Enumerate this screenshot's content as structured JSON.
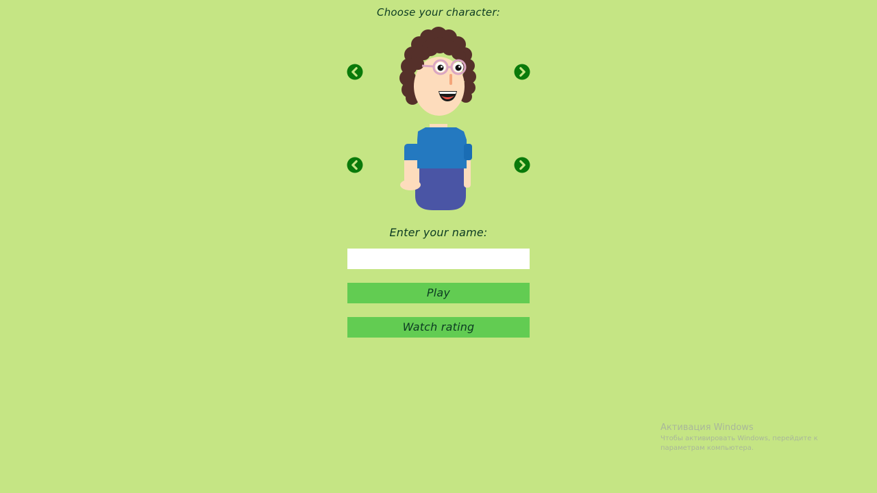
{
  "selection": {
    "title": "Choose your character:"
  },
  "form": {
    "name_label": "Enter your name:",
    "name_value": "",
    "name_placeholder": ""
  },
  "buttons": {
    "play_label": "Play",
    "rating_label": "Watch rating"
  },
  "windows_watermark": {
    "title": "Активация Windows",
    "subtitle": "Чтобы активировать Windows, перейдите к параметрам компьютера."
  },
  "icons": {
    "prev": "chevron-left-circle-icon",
    "next": "chevron-right-circle-icon"
  },
  "colors": {
    "background": "#c5e584",
    "button": "#62cc52",
    "arrow": "#0a7a0a",
    "text": "#0c3b22",
    "hair": "#55302a",
    "skin": "#fddcbc",
    "shirt": "#2479c0",
    "pants": "#4a55a5"
  }
}
